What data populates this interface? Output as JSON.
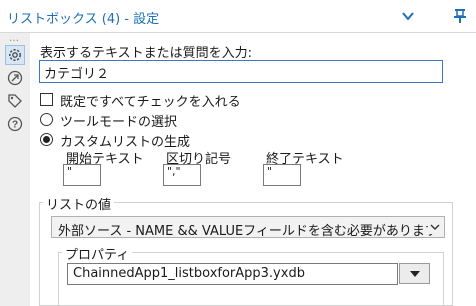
{
  "window": {
    "title": "リストボックス (4) - 設定"
  },
  "sidebar": {
    "more": "…",
    "icons": [
      "gear-icon",
      "connection-icon",
      "tag-icon",
      "help-icon"
    ]
  },
  "form": {
    "prompt_label": "表示するテキストまたは質問を入力:",
    "prompt_value": "カテゴリ２",
    "default_check_label": "既定ですべてチェックを入れる",
    "default_check_checked": false,
    "radio_tool_mode": "ツールモードの選択",
    "radio_custom": "カスタムリストの生成",
    "selected_radio": "custom",
    "start_text_label": "開始テキスト",
    "delimiter_label": "区切り記号",
    "end_text_label": "終了テキスト",
    "start_text_value": "\"",
    "delimiter_value": "\",\"",
    "end_text_value": "\""
  },
  "list_values": {
    "legend": "リストの値",
    "source_selected": "外部ソース -  NAME && VALUEフィールドを含む必要があります（相対パス）",
    "properties": {
      "legend": "プロパティ",
      "file_value": "ChainnedApp1_listboxforApp3.yxdb"
    }
  },
  "colors": {
    "title": "#1d6fb8",
    "sidebar_bg": "#eeeeee",
    "accent": "#3a78c2"
  }
}
